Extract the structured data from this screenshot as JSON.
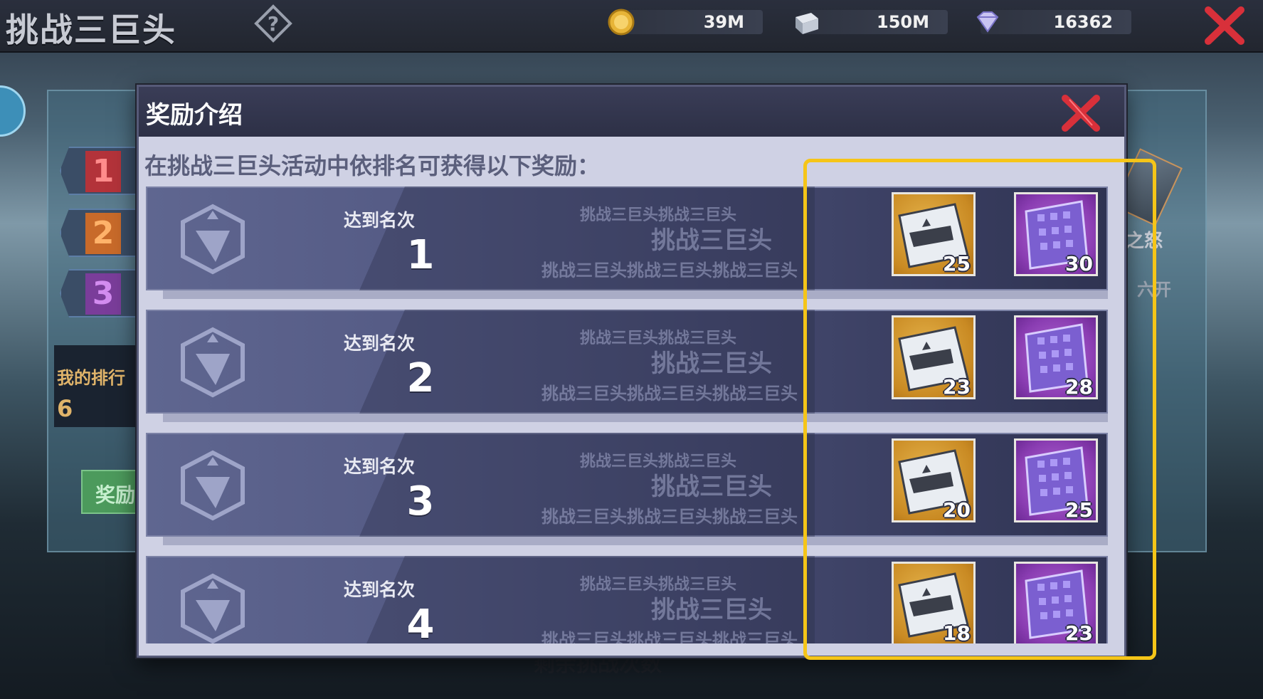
{
  "topbar": {
    "title": "挑战三巨头",
    "help_icon": "question-mark-diamond-icon",
    "resources": [
      {
        "name": "gold-coin",
        "value": "39M"
      },
      {
        "name": "steel",
        "value": "150M"
      },
      {
        "name": "diamond",
        "value": "16362"
      }
    ],
    "close_icon": "red-x-icon"
  },
  "background": {
    "rank_tabs": [
      "1",
      "2",
      "3"
    ],
    "my_rank_label": "我的排行",
    "my_rank_value": "6",
    "reward_button": "奖励",
    "right_text_1": "之怒",
    "right_text_2": "六开",
    "bottom_text": "剩余挑战次数"
  },
  "modal": {
    "title": "奖励介绍",
    "description": "在挑战三巨头活动中依排名可获得以下奖励：",
    "rank_label": "达到名次",
    "watermark_small": "挑战三巨头挑战三巨头",
    "watermark_big": "挑战三巨头",
    "watermark_long": "挑战三巨头挑战三巨头挑战三巨头",
    "rows": [
      {
        "rank": "1",
        "rewards": [
          {
            "type": "blueprint",
            "count": "25"
          },
          {
            "type": "tech-chip",
            "count": "30"
          }
        ]
      },
      {
        "rank": "2",
        "rewards": [
          {
            "type": "blueprint",
            "count": "23"
          },
          {
            "type": "tech-chip",
            "count": "28"
          }
        ]
      },
      {
        "rank": "3",
        "rewards": [
          {
            "type": "blueprint",
            "count": "20"
          },
          {
            "type": "tech-chip",
            "count": "25"
          }
        ]
      },
      {
        "rank": "4",
        "rewards": [
          {
            "type": "blueprint",
            "count": "18"
          },
          {
            "type": "tech-chip",
            "count": "23"
          }
        ]
      }
    ]
  },
  "colors": {
    "highlight": "#f5c518",
    "gold_reward": "#c98a23",
    "purple_reward": "#8a3db2",
    "close_red": "#d8303a"
  }
}
